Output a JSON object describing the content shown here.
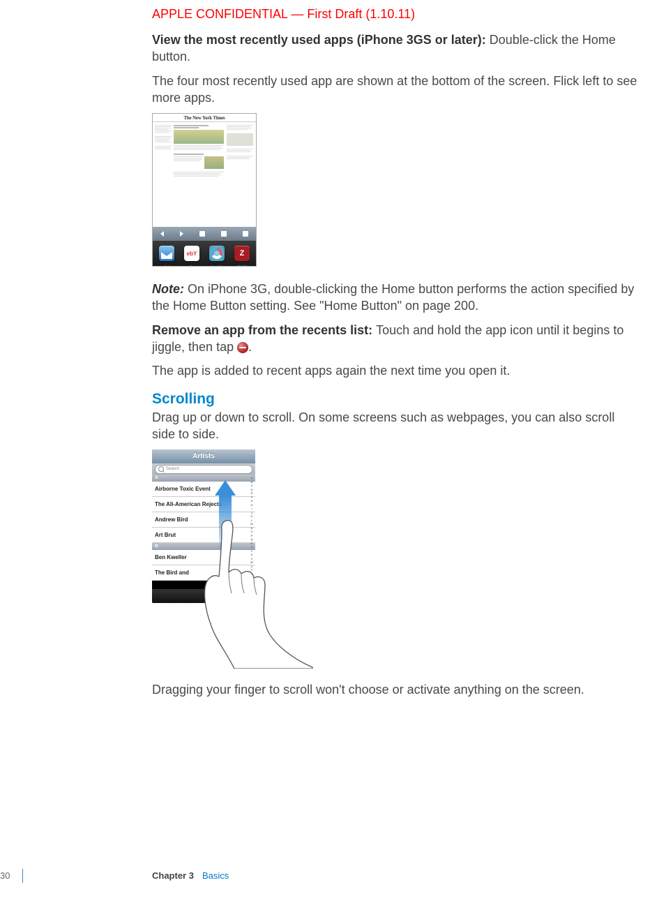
{
  "header": {
    "confidential": "APPLE CONFIDENTIAL — First Draft (1.10.11)"
  },
  "p1": {
    "lead": "View the most recently used apps (iPhone 3GS or later):  ",
    "body": "Double-click the Home button."
  },
  "p2": "The four most recently used app are shown at the bottom of the screen. Flick left to see more apps.",
  "fig1": {
    "masthead": "The New York Times",
    "apps": {
      "a": "Mail",
      "b": "eBay",
      "c": "AroundMe",
      "d": "ZAGAT"
    }
  },
  "p3": {
    "lead": "Note:  ",
    "body": "On iPhone 3G, double-clicking the Home button performs the action specified by the Home Button setting. See \"Home Button\" on page 200."
  },
  "p4": {
    "lead": "Remove an app from the recents list:  ",
    "body_a": "Touch and hold the app icon until it begins to jiggle, then tap ",
    "body_b": "."
  },
  "p5": "The app is added to recent apps again the next time you open it.",
  "scrolling": {
    "head": "Scrolling",
    "body": "Drag up or down to scroll. On some screens such as webpages, you can also scroll side to side."
  },
  "fig2": {
    "title": "Artists",
    "search": "Search",
    "sec_a": "A",
    "rows_a": [
      "Airborne Toxic Event",
      "The All-American Rejects",
      "Andrew Bird",
      "Art Brut"
    ],
    "sec_b": "B",
    "rows_b": [
      "Ben Kweller",
      "The Bird and"
    ],
    "index": "A B C D E F G H I J K L M N O P Q R S T U V W X Y Z #"
  },
  "p6": "Dragging your finger to scroll won't choose or activate anything on the screen.",
  "footer": {
    "page": "30",
    "chapter": "Chapter 3",
    "name": "Basics"
  }
}
